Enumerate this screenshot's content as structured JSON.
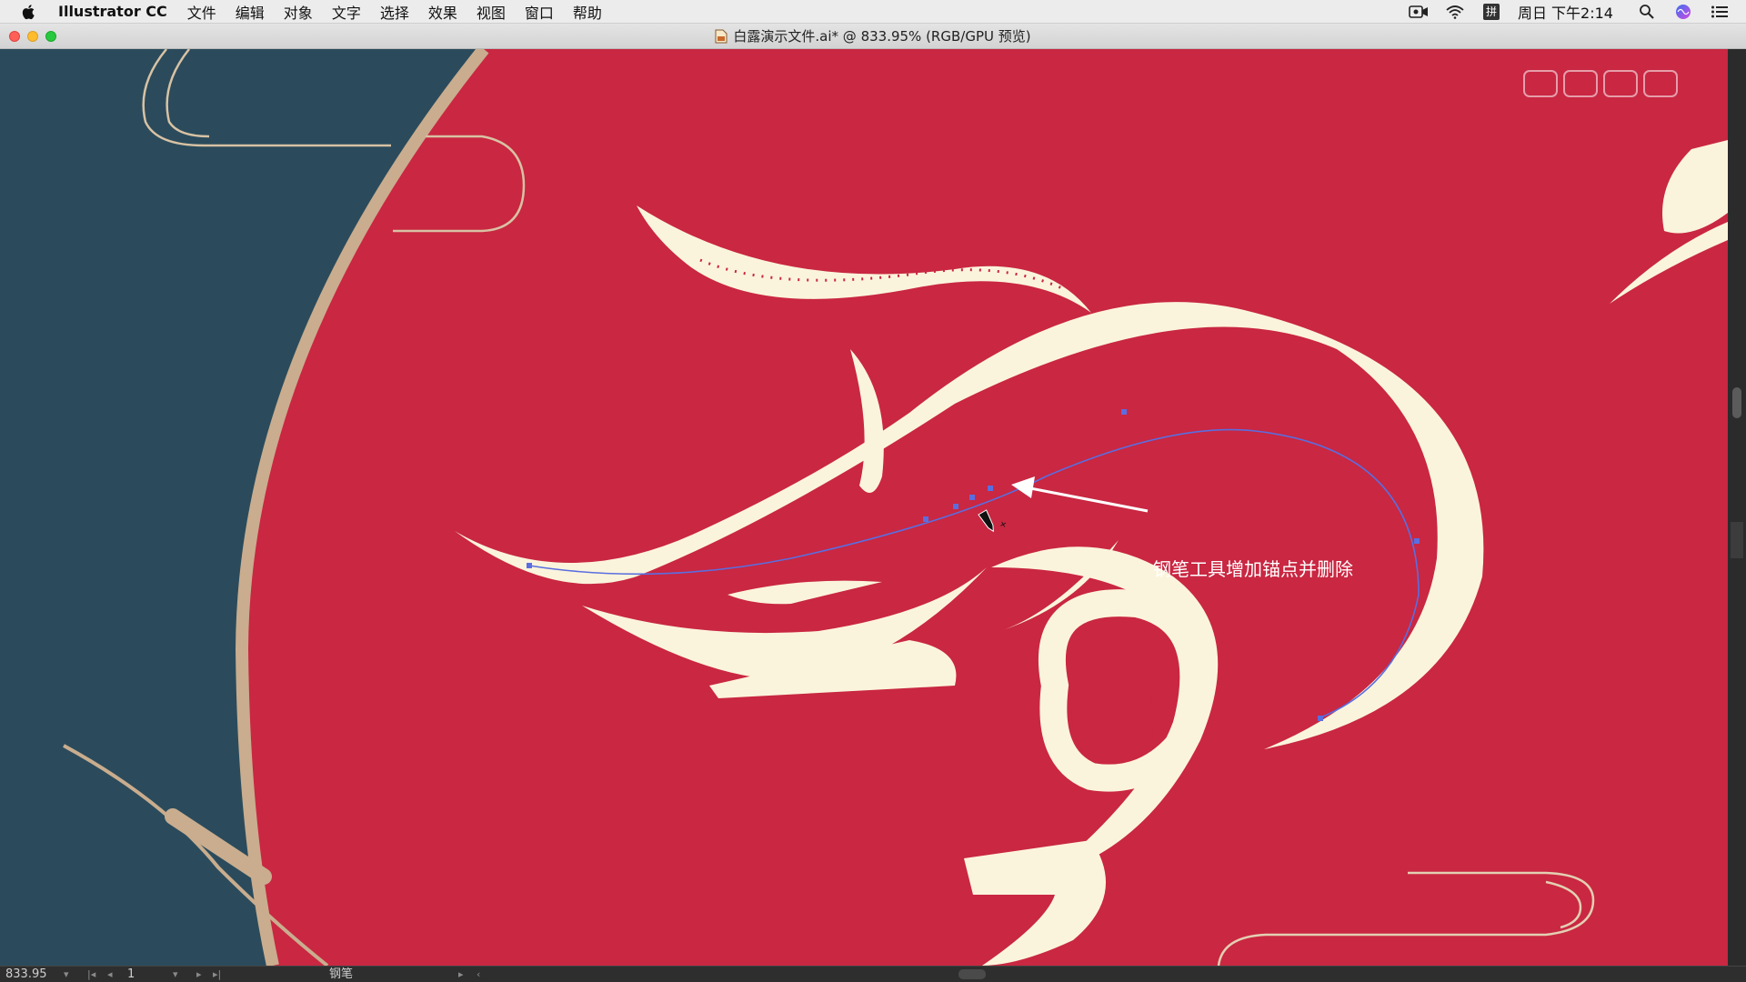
{
  "menubar": {
    "app_name": "Illustrator CC",
    "menus": [
      "文件",
      "编辑",
      "对象",
      "文字",
      "选择",
      "效果",
      "视图",
      "窗口",
      "帮助"
    ],
    "ime_label": "拼",
    "clock": "周日 下午2:14"
  },
  "titlebar": {
    "title": "白露演示文件.ai* @ 833.95% (RGB/GPU 预览)"
  },
  "canvas": {
    "annotation": "钢笔工具增加锚点并删除",
    "colors": {
      "background_red": "#c92742",
      "dark_blue": "#2b4b5c",
      "cream": "#fbf4dc",
      "tan": "#c9ad8e",
      "path_blue": "#5a6ee0"
    }
  },
  "statusbar": {
    "zoom": "833.95",
    "page": "1",
    "tool": "钢笔"
  }
}
